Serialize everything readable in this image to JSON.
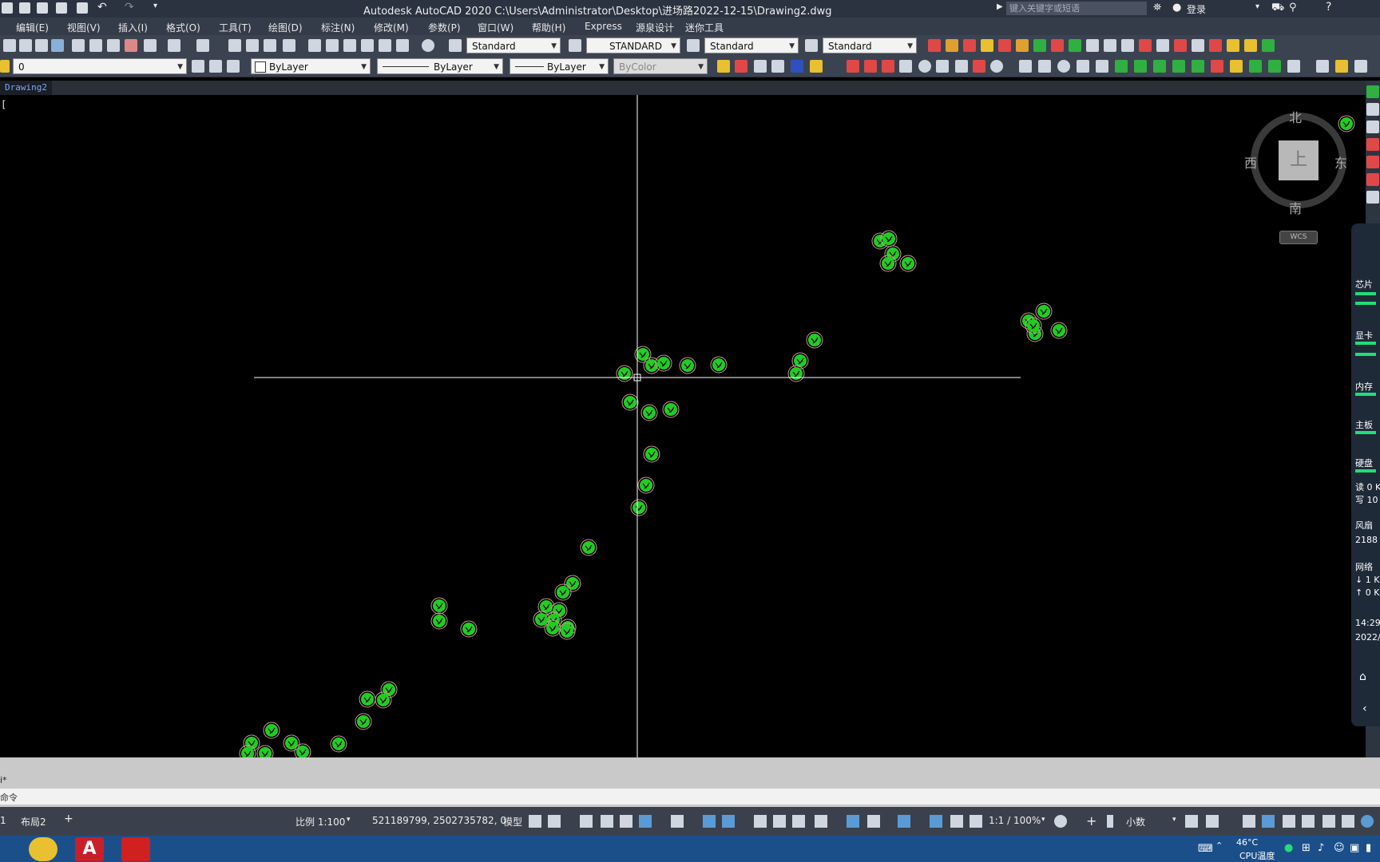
{
  "window": {
    "title": "Autodesk AutoCAD 2020    C:\\Users\\Administrator\\Desktop\\进场路2022-12-15\\Drawing2.dwg",
    "search_placeholder": "键入关键字或短语",
    "login": "登录"
  },
  "menu": [
    "编辑(E)",
    "视图(V)",
    "插入(I)",
    "格式(O)",
    "工具(T)",
    "绘图(D)",
    "标注(N)",
    "修改(M)",
    "参数(P)",
    "窗口(W)",
    "帮助(H)",
    "Express",
    "源泉设计",
    "迷你工具"
  ],
  "toolbar1": {
    "text_style": "Standard",
    "dim_style": "STANDARD",
    "table_style": "Standard",
    "mleader_style": "Standard"
  },
  "toolbar2": {
    "layer": "0",
    "color": "ByLayer",
    "linetype": "ByLayer",
    "lineweight": "ByLayer",
    "plotstyle": "ByColor"
  },
  "tabs": {
    "drawing": "Drawing2"
  },
  "viewport_label": "[",
  "viewcube": {
    "north": "北",
    "south": "南",
    "east": "东",
    "west": "西",
    "top": "上",
    "wcs": "WCS"
  },
  "monitor": {
    "chip": "芯片",
    "gpu": "显卡",
    "memory": "内存",
    "board": "主板",
    "disk": "硬盘",
    "read": "读 0 K",
    "write": "写 10",
    "fan": "风扇",
    "fan_value": "2188",
    "network": "网络",
    "down": "↓ 1 K",
    "up": "↑ 0 K",
    "time": "14:29",
    "date": "2022/"
  },
  "command": {
    "history_fragment": "i*",
    "prompt": "命令"
  },
  "status": {
    "layout_fragment": "1",
    "layout2": "布局2",
    "add": "+",
    "scale": "比例 1:100",
    "coords": "521189799, 2502735782, 0",
    "model": "模型",
    "annot_scale": "1:1 / 100%",
    "units": "小数"
  },
  "taskbar": {
    "temp": "46°C",
    "cpu": "CPU温度"
  },
  "colors": {
    "tree_green": "#22cc22",
    "crosshair": "#ffffff",
    "canvas": "#000000"
  },
  "trees": [
    [
      1686,
      155
    ],
    [
      1102,
      302
    ],
    [
      1113,
      299
    ],
    [
      1118,
      318
    ],
    [
      1112,
      330
    ],
    [
      1137,
      330
    ],
    [
      1288,
      402
    ],
    [
      1307,
      390
    ],
    [
      1296,
      418
    ],
    [
      1326,
      414
    ],
    [
      1294,
      408
    ],
    [
      1020,
      426
    ],
    [
      1002,
      452
    ],
    [
      997,
      468
    ],
    [
      805,
      444
    ],
    [
      816,
      458
    ],
    [
      831,
      455
    ],
    [
      861,
      458
    ],
    [
      900,
      457
    ],
    [
      782,
      468
    ],
    [
      789,
      504
    ],
    [
      813,
      517
    ],
    [
      840,
      513
    ],
    [
      816,
      569
    ],
    [
      809,
      608
    ],
    [
      800,
      636
    ],
    [
      737,
      686
    ],
    [
      717,
      731
    ],
    [
      705,
      742
    ],
    [
      684,
      760
    ],
    [
      700,
      765
    ],
    [
      693,
      777
    ],
    [
      711,
      786
    ],
    [
      692,
      787
    ],
    [
      678,
      776
    ],
    [
      710,
      791
    ],
    [
      550,
      759
    ],
    [
      550,
      778
    ],
    [
      587,
      788
    ],
    [
      487,
      864
    ],
    [
      460,
      876
    ],
    [
      480,
      877
    ],
    [
      455,
      904
    ],
    [
      424,
      932
    ],
    [
      340,
      915
    ],
    [
      315,
      931
    ],
    [
      365,
      931
    ],
    [
      379,
      942
    ],
    [
      332,
      944
    ],
    [
      310,
      944
    ]
  ]
}
